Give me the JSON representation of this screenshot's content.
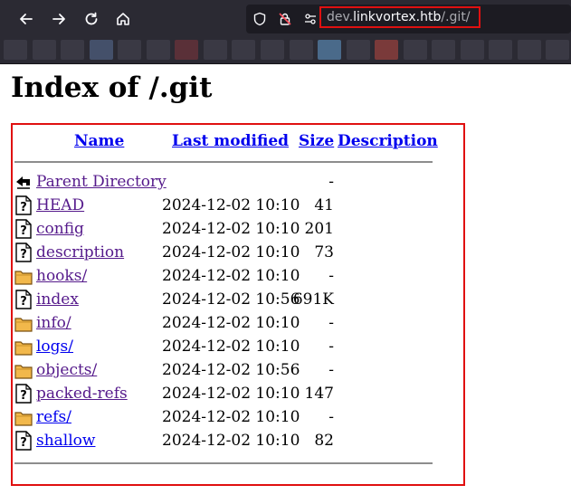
{
  "browser": {
    "url_prefix": "dev.",
    "url_host": "linkvortex.htb",
    "url_path": "/.git/",
    "bookmark_colors": [
      "#3a3944",
      "#3a3944",
      "#3a3944",
      "#44506a",
      "#3a3944",
      "#3a3944",
      "#5a3038",
      "#3a3944",
      "#3a3944",
      "#3a3944",
      "#3a3944",
      "#4a6a8a",
      "#3a3944",
      "#7a3a3a",
      "#3a3944",
      "#3a3944",
      "#3a3944",
      "#3a3944",
      "#3a3944",
      "#3a3944"
    ]
  },
  "page": {
    "title": "Index of /.git",
    "columns": {
      "name": "Name",
      "last_modified": "Last modified",
      "size": "Size",
      "description": "Description"
    },
    "entries": [
      {
        "icon": "back-icon",
        "name": "Parent Directory",
        "date": "",
        "size": "-",
        "visited": true
      },
      {
        "icon": "file-icon",
        "name": "HEAD",
        "date": "2024-12-02 10:10",
        "size": "41",
        "visited": true
      },
      {
        "icon": "file-icon",
        "name": "config",
        "date": "2024-12-02 10:10",
        "size": "201",
        "visited": true
      },
      {
        "icon": "file-icon",
        "name": "description",
        "date": "2024-12-02 10:10",
        "size": "73",
        "visited": true
      },
      {
        "icon": "folder-icon",
        "name": "hooks/",
        "date": "2024-12-02 10:10",
        "size": "-",
        "visited": true
      },
      {
        "icon": "file-icon",
        "name": "index",
        "date": "2024-12-02 10:56",
        "size": "691K",
        "visited": true
      },
      {
        "icon": "folder-icon",
        "name": "info/",
        "date": "2024-12-02 10:10",
        "size": "-",
        "visited": true
      },
      {
        "icon": "folder-icon",
        "name": "logs/",
        "date": "2024-12-02 10:10",
        "size": "-",
        "visited": false
      },
      {
        "icon": "folder-icon",
        "name": "objects/",
        "date": "2024-12-02 10:56",
        "size": "-",
        "visited": true
      },
      {
        "icon": "file-icon",
        "name": "packed-refs",
        "date": "2024-12-02 10:10",
        "size": "147",
        "visited": true
      },
      {
        "icon": "folder-icon",
        "name": "refs/",
        "date": "2024-12-02 10:10",
        "size": "-",
        "visited": false
      },
      {
        "icon": "file-icon",
        "name": "shallow",
        "date": "2024-12-02 10:10",
        "size": "82",
        "visited": false
      }
    ]
  }
}
